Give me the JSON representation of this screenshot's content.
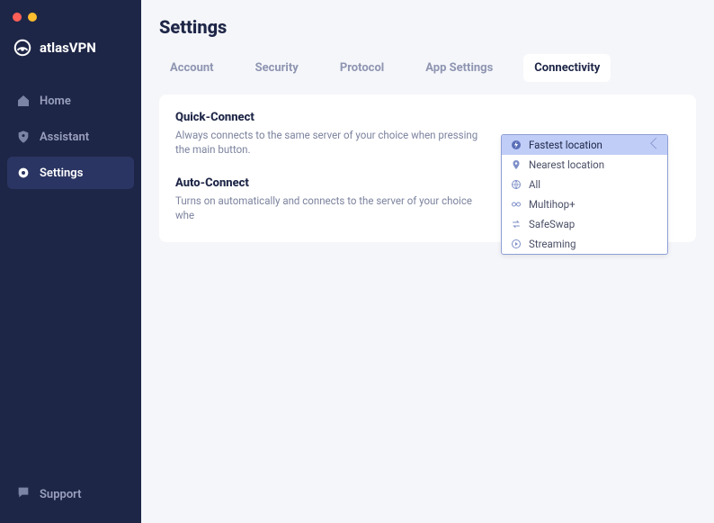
{
  "brand": {
    "name": "atlasVPN"
  },
  "sidebar": {
    "items": [
      {
        "label": "Home"
      },
      {
        "label": "Assistant"
      },
      {
        "label": "Settings"
      }
    ],
    "support_label": "Support"
  },
  "page": {
    "title": "Settings",
    "tabs": [
      {
        "label": "Account"
      },
      {
        "label": "Security"
      },
      {
        "label": "Protocol"
      },
      {
        "label": "App Settings"
      },
      {
        "label": "Connectivity"
      }
    ],
    "settings": [
      {
        "title": "Quick-Connect",
        "description": "Always connects to the same server of your choice when pressing the main button."
      },
      {
        "title": "Auto-Connect",
        "description": "Turns on automatically and connects to the server of your choice whe"
      }
    ]
  },
  "dropdown": {
    "options": [
      {
        "label": "Fastest location"
      },
      {
        "label": "Nearest location"
      },
      {
        "label": "All"
      },
      {
        "label": "Multihop+"
      },
      {
        "label": "SafeSwap"
      },
      {
        "label": "Streaming"
      }
    ],
    "selected_index": 0
  }
}
